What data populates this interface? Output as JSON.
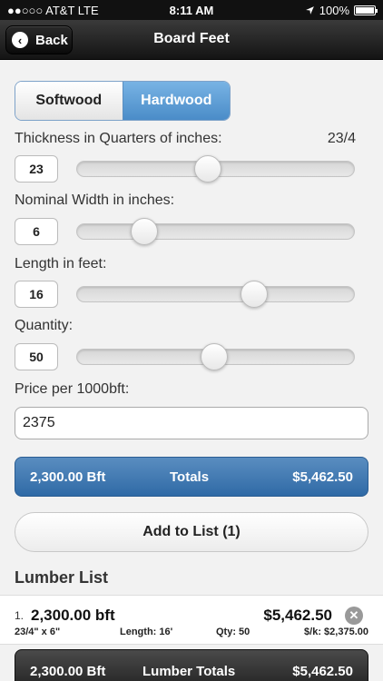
{
  "status": {
    "carrier": "●●○○○ AT&T  LTE",
    "time": "8:11 AM",
    "battery": "100%",
    "battery_level": 1.0,
    "location_icon": "location-arrow-icon"
  },
  "nav": {
    "back_label": "Back",
    "title": "Board Feet"
  },
  "segment": {
    "softwood": "Softwood",
    "hardwood": "Hardwood",
    "selected": "Hardwood"
  },
  "thickness": {
    "label": "Thickness in Quarters of inches:",
    "display": "23/4",
    "value": "23",
    "min": 1,
    "max": 48,
    "numeric": 23
  },
  "width": {
    "label": "Nominal Width in inches:",
    "value": "6",
    "min": 1,
    "max": 24,
    "numeric": 6
  },
  "length": {
    "label": "Length in feet:",
    "value": "16",
    "min": 1,
    "max": 24,
    "numeric": 16
  },
  "quantity": {
    "label": "Quantity:",
    "value": "50",
    "min": 1,
    "max": 100,
    "numeric": 50
  },
  "price": {
    "label": "Price per 1000bft:",
    "value": "2375"
  },
  "totals": {
    "bft": "2,300.00 Bft",
    "label": "Totals",
    "amount": "$5,462.50"
  },
  "add_button": "Add to List (1)",
  "lumber_list": {
    "header": "Lumber List",
    "items": [
      {
        "index": "1.",
        "bft": "2,300.00 bft",
        "price": "$5,462.50",
        "dims": "23/4\" x 6\"",
        "length": "Length: 16'",
        "qty": "Qty: 50",
        "rate": "$/k: $2,375.00"
      }
    ]
  },
  "lumber_totals": {
    "bft": "2,300.00 Bft",
    "label": "Lumber Totals",
    "amount": "$5,462.50"
  }
}
